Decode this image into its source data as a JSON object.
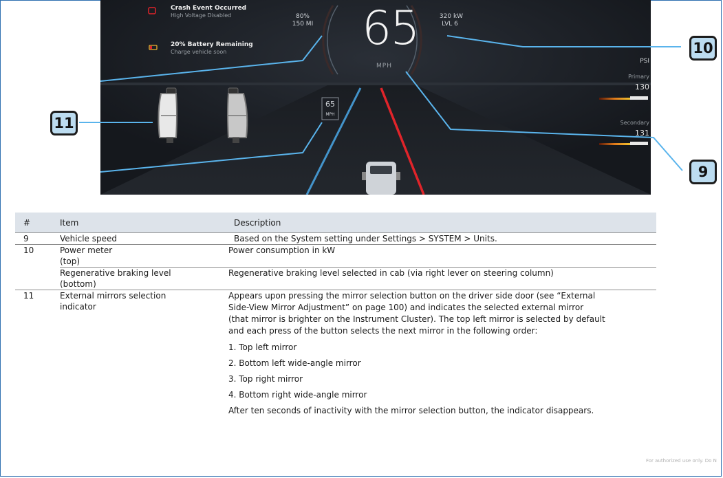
{
  "dashboard": {
    "alert1_title": "Crash Event Occurred",
    "alert1_sub": "High Voltage Disabled",
    "alert2_title": "20% Battery Remaining",
    "alert2_sub": "Charge vehicle soon",
    "left_readout_1": "80%",
    "left_readout_2": "150 MI",
    "right_readout_1": "320 kW",
    "right_readout_2": "LVL 6",
    "speed": "65",
    "speed_unit": "MPH",
    "small_speed": "65",
    "small_speed_unit": "MPH",
    "psi_label": "PSI",
    "primary_label": "Primary",
    "primary_value": "130",
    "secondary_label": "Secondary",
    "secondary_value": "131",
    "accent_color": "#4aa8e8",
    "lane_red": "#e0242a"
  },
  "callouts": {
    "c10": "10",
    "c11": "11",
    "c9": "9"
  },
  "table": {
    "headers": {
      "num": "#",
      "item": "Item",
      "desc": "Description"
    },
    "row9": {
      "num": "9",
      "item": "Vehicle speed",
      "desc": "Based on the System setting under Settings > SYSTEM > Units."
    },
    "row10": {
      "num": "10",
      "item_a": "Power meter",
      "item_b": "(top)",
      "desc": "Power consumption in kW"
    },
    "row10b": {
      "item_a": "Regenerative braking level",
      "item_b": "(bottom)",
      "desc": "Regenerative braking level selected in cab (via right lever on steering column)"
    },
    "row11": {
      "num": "11",
      "item_a": "External mirrors selection",
      "item_b": "indicator",
      "desc_l1": "Appears upon pressing the mirror selection button on the driver side door (see “External",
      "desc_l2": "Side-View Mirror Adjustment” on page 100) and indicates the selected external mirror",
      "desc_l3": "(that mirror is brighter on the Instrument Cluster). The top left mirror is selected by default",
      "desc_l4": "and each press of the button selects the next mirror in the following order:",
      "list": [
        "1. Top left mirror",
        "2. Bottom left wide-angle mirror",
        "3. Top right mirror",
        "4. Bottom right wide-angle mirror"
      ],
      "desc_end": "After ten seconds of inactivity with the mirror selection button, the indicator disappears."
    }
  },
  "footer_note": "For authorized use only. Do N"
}
